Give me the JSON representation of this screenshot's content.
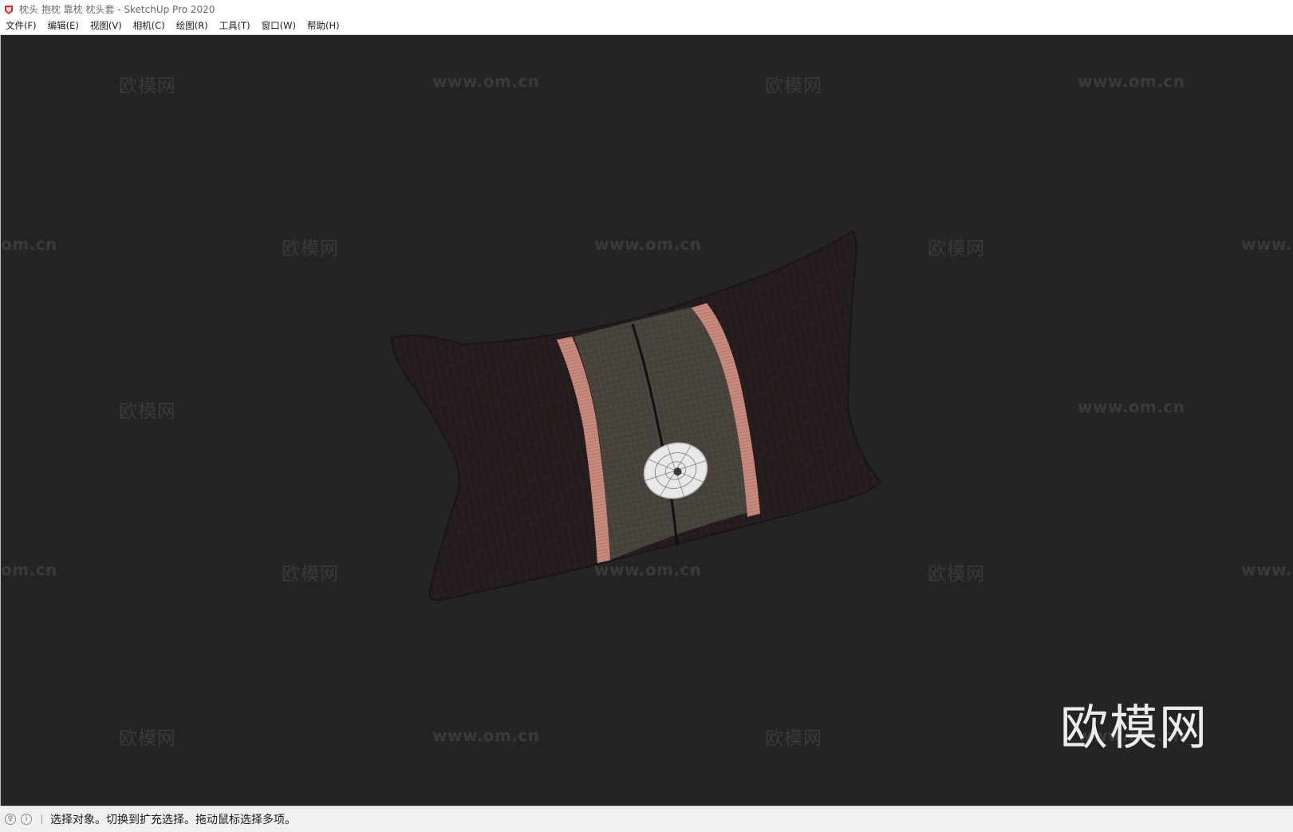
{
  "window": {
    "title": "枕头 抱枕 靠枕 枕头套 - SketchUp Pro 2020"
  },
  "menu": [
    {
      "label": "文件(F)"
    },
    {
      "label": "编辑(E)"
    },
    {
      "label": "视图(V)"
    },
    {
      "label": "相机(C)"
    },
    {
      "label": "绘图(R)"
    },
    {
      "label": "工具(T)"
    },
    {
      "label": "窗口(W)"
    },
    {
      "label": "帮助(H)"
    }
  ],
  "watermark": {
    "logo_text": "欧模网",
    "url_text": "www.om.cn",
    "url_cut_left": "om.cn",
    "url_cut_right": "www.o"
  },
  "status": {
    "message": "选择对象。切换到扩充选择。拖动鼠标选择多项。"
  },
  "colors": {
    "viewport_bg": "#242424",
    "pillow_body": "#241c1c",
    "center_band": "#45403a",
    "stripe": "#c98a7e",
    "button": "#e8e8e8"
  }
}
